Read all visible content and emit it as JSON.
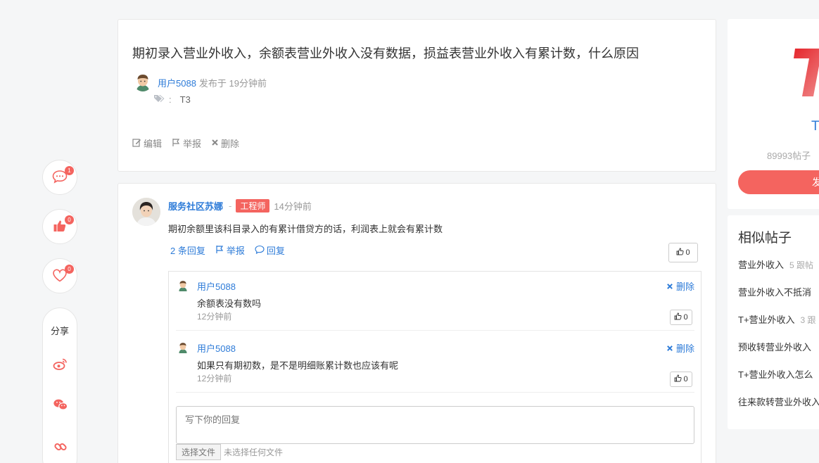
{
  "question": {
    "title": "期初录入营业外收入，余额表营业外收入没有数据，损益表营业外收入有累计数，什么原因",
    "author": "用户5088",
    "posted": "发布于 19分钟前",
    "tag_sep": ":",
    "tag": "T3",
    "actions": {
      "edit": "编辑",
      "report": "举报",
      "delete": "删除"
    }
  },
  "sidebar": {
    "comment_count": "1",
    "like_count": "0",
    "fav_count": "0",
    "share_label": "分享"
  },
  "answer": {
    "author": "服务社区苏娜",
    "sep": "-",
    "role_badge": "工程师",
    "time": "14分钟前",
    "content": "期初余额里该科目录入的有累计借贷方的话，利润表上就会有累计数",
    "replies_link": "2 条回复",
    "report": "举报",
    "reply": "回复",
    "likes": "0",
    "replies": [
      {
        "author": "用户5088",
        "text": "余额表没有数吗",
        "time": "12分钟前",
        "delete": "删除",
        "likes": "0"
      },
      {
        "author": "用户5088",
        "text": "如果只有期初数，是不是明细账累计数也应该有呢",
        "time": "12分钟前",
        "delete": "删除",
        "likes": "0"
      }
    ],
    "reply_placeholder": "写下你的回复",
    "file_button": "选择文件",
    "file_status": "未选择任何文件"
  },
  "right": {
    "brand": "T",
    "stats": "89993帖子",
    "button": "发",
    "similar_title": "相似帖子",
    "similar": [
      {
        "title": "营业外收入",
        "count": "5 跟帖"
      },
      {
        "title": "营业外收入不抵消",
        "count": ""
      },
      {
        "title": "T+营业外收入",
        "count": "3 跟"
      },
      {
        "title": "预收转营业外收入",
        "count": ""
      },
      {
        "title": "T+营业外收入怎么",
        "count": ""
      },
      {
        "title": "往来款转营业外收入",
        "count": ""
      }
    ]
  },
  "colors": {
    "accent": "#f4645f",
    "link": "#2d7bd8"
  }
}
